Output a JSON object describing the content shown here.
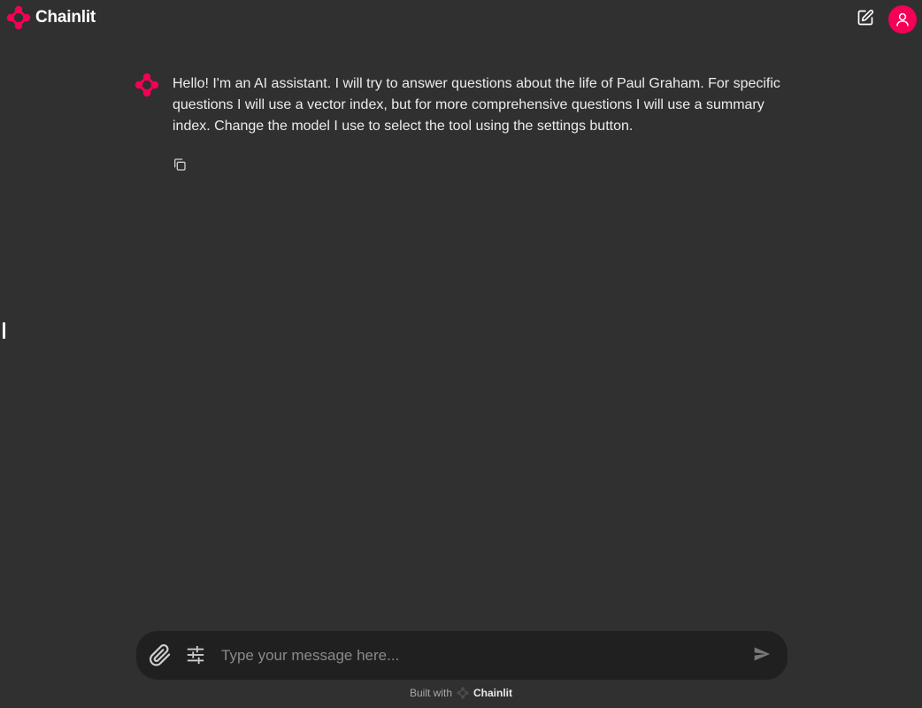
{
  "header": {
    "brand_name": "Chainlit",
    "brand_color": "#f50057",
    "new_chat_icon": "edit-icon",
    "user_icon": "user-icon"
  },
  "message": {
    "author_icon": "chainlit-logo-icon",
    "text": "Hello! I'm an AI assistant. I will try to answer questions about the life of Paul Graham. For specific questions I will use a vector index, but for more comprehensive questions I will use a summary index. Change the model I use to select the tool using the settings button.",
    "copy_icon": "copy-icon"
  },
  "composer": {
    "placeholder": "Type your message here...",
    "value": "",
    "attach_icon": "paperclip-icon",
    "settings_icon": "sliders-icon",
    "send_icon": "send-icon"
  },
  "footer": {
    "built_with_label": "Built with",
    "brand_name": "Chainlit"
  },
  "colors": {
    "background": "#303030",
    "composer_bg": "#202020",
    "accent": "#f50057"
  }
}
